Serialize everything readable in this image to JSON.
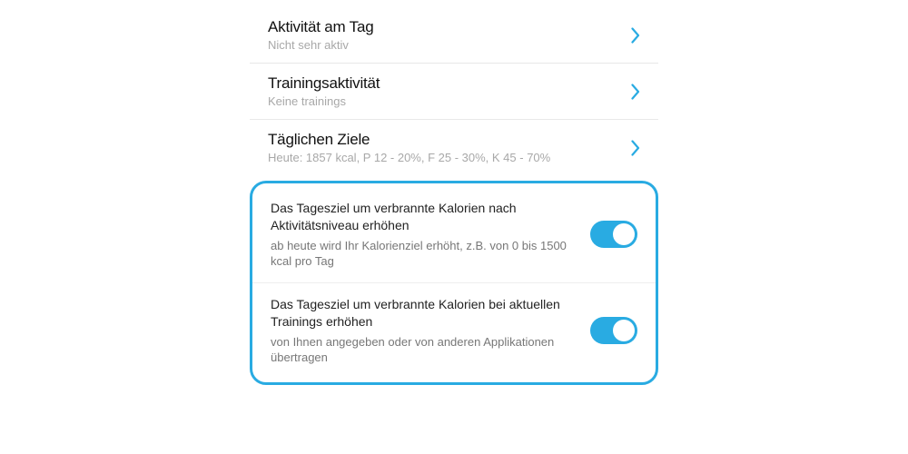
{
  "items": [
    {
      "title": "Aktivität am Tag",
      "subtitle": "Nicht sehr aktiv"
    },
    {
      "title": "Trainingsaktivität",
      "subtitle": "Keine trainings"
    },
    {
      "title": "Täglichen Ziele",
      "subtitle": "Heute: 1857 kcal, P 12 - 20%, F 25 - 30%, K 45 - 70%"
    }
  ],
  "toggles": [
    {
      "title": "Das Tagesziel um verbrannte Kalorien nach Aktivitätsniveau erhöhen",
      "desc": "ab heute wird Ihr Kalorienziel erhöht, z.B. von 0 bis 1500 kcal pro Tag",
      "on": true
    },
    {
      "title": "Das Tagesziel um verbrannte Kalorien bei aktuellen Trainings erhöhen",
      "desc": "von Ihnen angegeben oder von anderen Applikationen übertragen",
      "on": true
    }
  ],
  "colors": {
    "accent": "#29abe2"
  }
}
